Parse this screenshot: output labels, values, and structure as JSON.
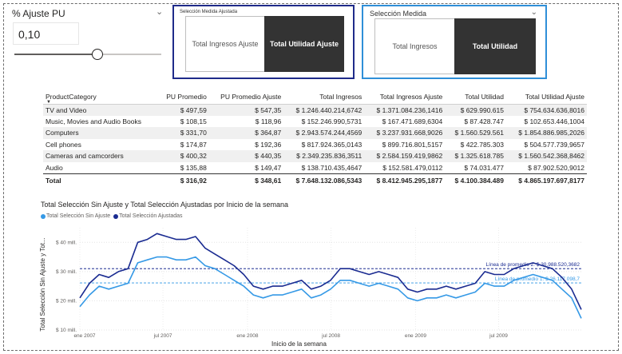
{
  "slicer": {
    "title": "% Ajuste PU",
    "value": "0,10"
  },
  "panel_ajustada": {
    "title": "Selección Medida Ajustada",
    "buttons": [
      "Total Ingresos Ajuste",
      "Total Utilidad Ajuste"
    ]
  },
  "panel_medida": {
    "title": "Selección Medida",
    "buttons": [
      "Total Ingresos",
      "Total Utilidad"
    ]
  },
  "table": {
    "columns": [
      "ProductCategory",
      "PU Promedio",
      "PU Promedio Ajuste",
      "Total Ingresos",
      "Total Ingresos Ajuste",
      "Total Utilidad",
      "Total Utilidad Ajuste"
    ],
    "rows": [
      [
        "TV and Video",
        "$ 497,59",
        "$ 547,35",
        "$ 1.246.440.214,6742",
        "$ 1.371.084.236,1416",
        "$ 629.990.615",
        "$ 754.634.636,8016"
      ],
      [
        "Music, Movies and Audio Books",
        "$ 108,15",
        "$ 118,96",
        "$ 152.246.990,5731",
        "$ 167.471.689,6304",
        "$ 87.428.747",
        "$ 102.653.446,1004"
      ],
      [
        "Computers",
        "$ 331,70",
        "$ 364,87",
        "$ 2.943.574.244,4569",
        "$ 3.237.931.668,9026",
        "$ 1.560.529.561",
        "$ 1.854.886.985,2026"
      ],
      [
        "Cell phones",
        "$ 174,87",
        "$ 192,36",
        "$ 817.924.365,0143",
        "$ 899.716.801,5157",
        "$ 422.785.303",
        "$ 504.577.739,9657"
      ],
      [
        "Cameras and camcorders",
        "$ 400,32",
        "$ 440,35",
        "$ 2.349.235.836,3511",
        "$ 2.584.159.419,9862",
        "$ 1.325.618.785",
        "$ 1.560.542.368,8462"
      ],
      [
        "Audio",
        "$ 135,88",
        "$ 149,47",
        "$ 138.710.435,4647",
        "$ 152.581.479,0112",
        "$ 74.031.477",
        "$ 87.902.520,9012"
      ]
    ],
    "total": [
      "Total",
      "$ 316,92",
      "$ 348,61",
      "$ 7.648.132.086,5343",
      "$ 8.412.945.295,1877",
      "$ 4.100.384.489",
      "$ 4.865.197.697,8177"
    ]
  },
  "chart": {
    "title": "Total Selección Sin Ajuste y Total Selección Ajustadas por Inicio de la semana",
    "xlabel": "Inicio de la semana",
    "ylabel": "Total Selección Sin Ajuste y Tot...",
    "yticks": [
      "$ 40 mill.",
      "$ 30 mill.",
      "$ 20 mill.",
      "$ 10 mill."
    ],
    "xticks": [
      "ene 2007",
      "jul 2007",
      "ene 2008",
      "jul 2008",
      "ene 2009",
      "jul 2009"
    ],
    "ref_labels": [
      "Línea de promedio 2: $ 30.988.520,3682",
      "Línea de promedio 1: $ 26.117.098,7"
    ]
  },
  "colors": {
    "sin_ajuste": "#3599e6",
    "ajustada": "#1a2b91",
    "panel1_border": "#1f2b8a",
    "panel2_border": "#2f8fd8",
    "dark_button": "#333333"
  },
  "chart_data": {
    "type": "line",
    "title": "Total Selección Sin Ajuste y Total Selección Ajustadas por Inicio de la semana",
    "xlabel": "Inicio de la semana",
    "ylabel": "Total Selección Sin Ajuste y Tot...",
    "ylim": [
      10,
      45
    ],
    "x_range": [
      "2007-01-01",
      "2009-12-28"
    ],
    "y_unit": "mill.",
    "grid": true,
    "legend_position": "top-left",
    "reference_lines": [
      {
        "label": "Línea de promedio 2",
        "value": 30.99,
        "series": "Total Selección Ajustadas"
      },
      {
        "label": "Línea de promedio 1",
        "value": 26.12,
        "series": "Total Selección Sin Ajuste"
      }
    ],
    "series": [
      {
        "name": "Total Selección Sin Ajuste",
        "x": [
          "2007-01-01",
          "2007-01-22",
          "2007-02-12",
          "2007-03-05",
          "2007-03-26",
          "2007-04-16",
          "2007-05-07",
          "2007-05-28",
          "2007-06-18",
          "2007-07-09",
          "2007-07-30",
          "2007-08-20",
          "2007-09-10",
          "2007-10-01",
          "2007-10-22",
          "2007-11-12",
          "2007-12-03",
          "2007-12-24",
          "2008-01-14",
          "2008-02-04",
          "2008-02-25",
          "2008-03-17",
          "2008-04-07",
          "2008-04-28",
          "2008-05-19",
          "2008-06-09",
          "2008-06-30",
          "2008-07-21",
          "2008-08-11",
          "2008-09-01",
          "2008-09-22",
          "2008-10-13",
          "2008-11-03",
          "2008-11-24",
          "2008-12-15",
          "2009-01-05",
          "2009-01-26",
          "2009-02-16",
          "2009-03-09",
          "2009-03-30",
          "2009-04-20",
          "2009-05-11",
          "2009-06-01",
          "2009-06-22",
          "2009-07-13",
          "2009-08-03",
          "2009-08-24",
          "2009-09-14",
          "2009-10-05",
          "2009-10-26",
          "2009-11-16",
          "2009-12-07",
          "2009-12-28"
        ],
        "values": [
          18,
          22,
          25,
          24,
          25,
          26,
          33,
          34,
          35,
          35,
          34,
          34,
          35,
          32,
          31,
          29,
          27,
          25,
          22,
          21,
          22,
          22,
          23,
          24,
          21,
          22,
          24,
          27,
          27,
          26,
          25,
          26,
          25,
          24,
          21,
          20,
          21,
          21,
          22,
          21,
          22,
          23,
          26,
          25,
          25,
          27,
          28,
          29,
          28,
          27,
          24,
          21,
          14
        ]
      },
      {
        "name": "Total Selección Ajustadas",
        "x": [
          "2007-01-01",
          "2007-01-22",
          "2007-02-12",
          "2007-03-05",
          "2007-03-26",
          "2007-04-16",
          "2007-05-07",
          "2007-05-28",
          "2007-06-18",
          "2007-07-09",
          "2007-07-30",
          "2007-08-20",
          "2007-09-10",
          "2007-10-01",
          "2007-10-22",
          "2007-11-12",
          "2007-12-03",
          "2007-12-24",
          "2008-01-14",
          "2008-02-04",
          "2008-02-25",
          "2008-03-17",
          "2008-04-07",
          "2008-04-28",
          "2008-05-19",
          "2008-06-09",
          "2008-06-30",
          "2008-07-21",
          "2008-08-11",
          "2008-09-01",
          "2008-09-22",
          "2008-10-13",
          "2008-11-03",
          "2008-11-24",
          "2008-12-15",
          "2009-01-05",
          "2009-01-26",
          "2009-02-16",
          "2009-03-09",
          "2009-03-30",
          "2009-04-20",
          "2009-05-11",
          "2009-06-01",
          "2009-06-22",
          "2009-07-13",
          "2009-08-03",
          "2009-08-24",
          "2009-09-14",
          "2009-10-05",
          "2009-10-26",
          "2009-11-16",
          "2009-12-07",
          "2009-12-28"
        ],
        "values": [
          21,
          26,
          29,
          28,
          30,
          31,
          40,
          41,
          43,
          42,
          41,
          41,
          42,
          38,
          36,
          34,
          32,
          29,
          25,
          24,
          25,
          25,
          26,
          27,
          24,
          25,
          27,
          31,
          31,
          30,
          29,
          30,
          29,
          28,
          24,
          23,
          24,
          24,
          25,
          24,
          25,
          26,
          30,
          29,
          29,
          31,
          32,
          33,
          32,
          31,
          28,
          24,
          17
        ]
      }
    ]
  }
}
